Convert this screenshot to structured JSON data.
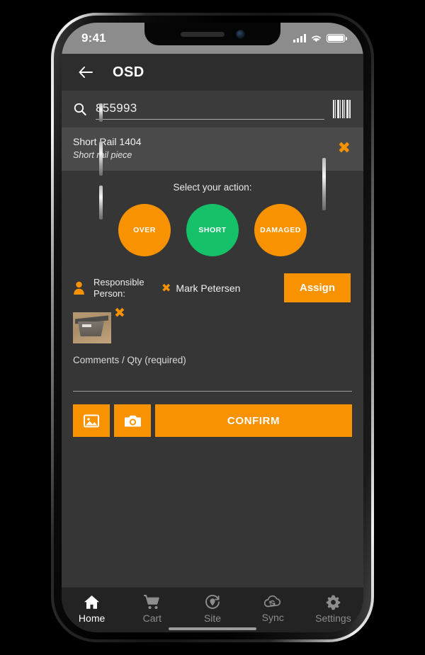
{
  "status_bar": {
    "time": "9:41",
    "signal_icon": "cellular-signal-icon",
    "wifi_icon": "wifi-icon",
    "battery_icon": "battery-full-icon"
  },
  "header": {
    "back_icon": "back-arrow-icon",
    "title": "OSD"
  },
  "search": {
    "icon": "search-icon",
    "value": "855993",
    "barcode_icon": "barcode-scanner-icon"
  },
  "item": {
    "name": "Short Rail 1404",
    "description": "Short rail piece",
    "remove_icon": "close-x-icon"
  },
  "action_section": {
    "prompt": "Select your action:",
    "options": [
      {
        "label": "OVER",
        "color": "#f99200",
        "selected": false
      },
      {
        "label": "SHORT",
        "color": "#15c26a",
        "selected": true
      },
      {
        "label": "DAMAGED",
        "color": "#f99200",
        "selected": false
      }
    ]
  },
  "responsible": {
    "person_icon": "person-icon",
    "label": "Responsible Person:",
    "remove_icon": "close-x-icon",
    "assignee": "Mark Petersen",
    "assign_button": "Assign"
  },
  "attachment": {
    "thumbnail_alt": "photo-thumbnail",
    "remove_icon": "close-x-icon"
  },
  "comments": {
    "placeholder": "Comments / Qty (required)",
    "value": ""
  },
  "action_bar": {
    "gallery_icon": "image-gallery-icon",
    "camera_icon": "camera-icon",
    "confirm_label": "CONFIRM"
  },
  "bottom_nav": {
    "items": [
      {
        "label": "Home",
        "icon": "home-icon",
        "active": true
      },
      {
        "label": "Cart",
        "icon": "cart-icon",
        "active": false
      },
      {
        "label": "Site",
        "icon": "site-pin-icon",
        "active": false
      },
      {
        "label": "Sync",
        "icon": "cloud-sync-icon",
        "active": false
      },
      {
        "label": "Settings",
        "icon": "gear-icon",
        "active": false
      }
    ]
  },
  "theme": {
    "orange": "#f99200",
    "green": "#15c26a",
    "background": "#363636",
    "header_bg": "#2d2d2d",
    "search_bg": "#3b3b3b",
    "item_bg": "#4a4a4a",
    "nav_bg": "#232323"
  }
}
